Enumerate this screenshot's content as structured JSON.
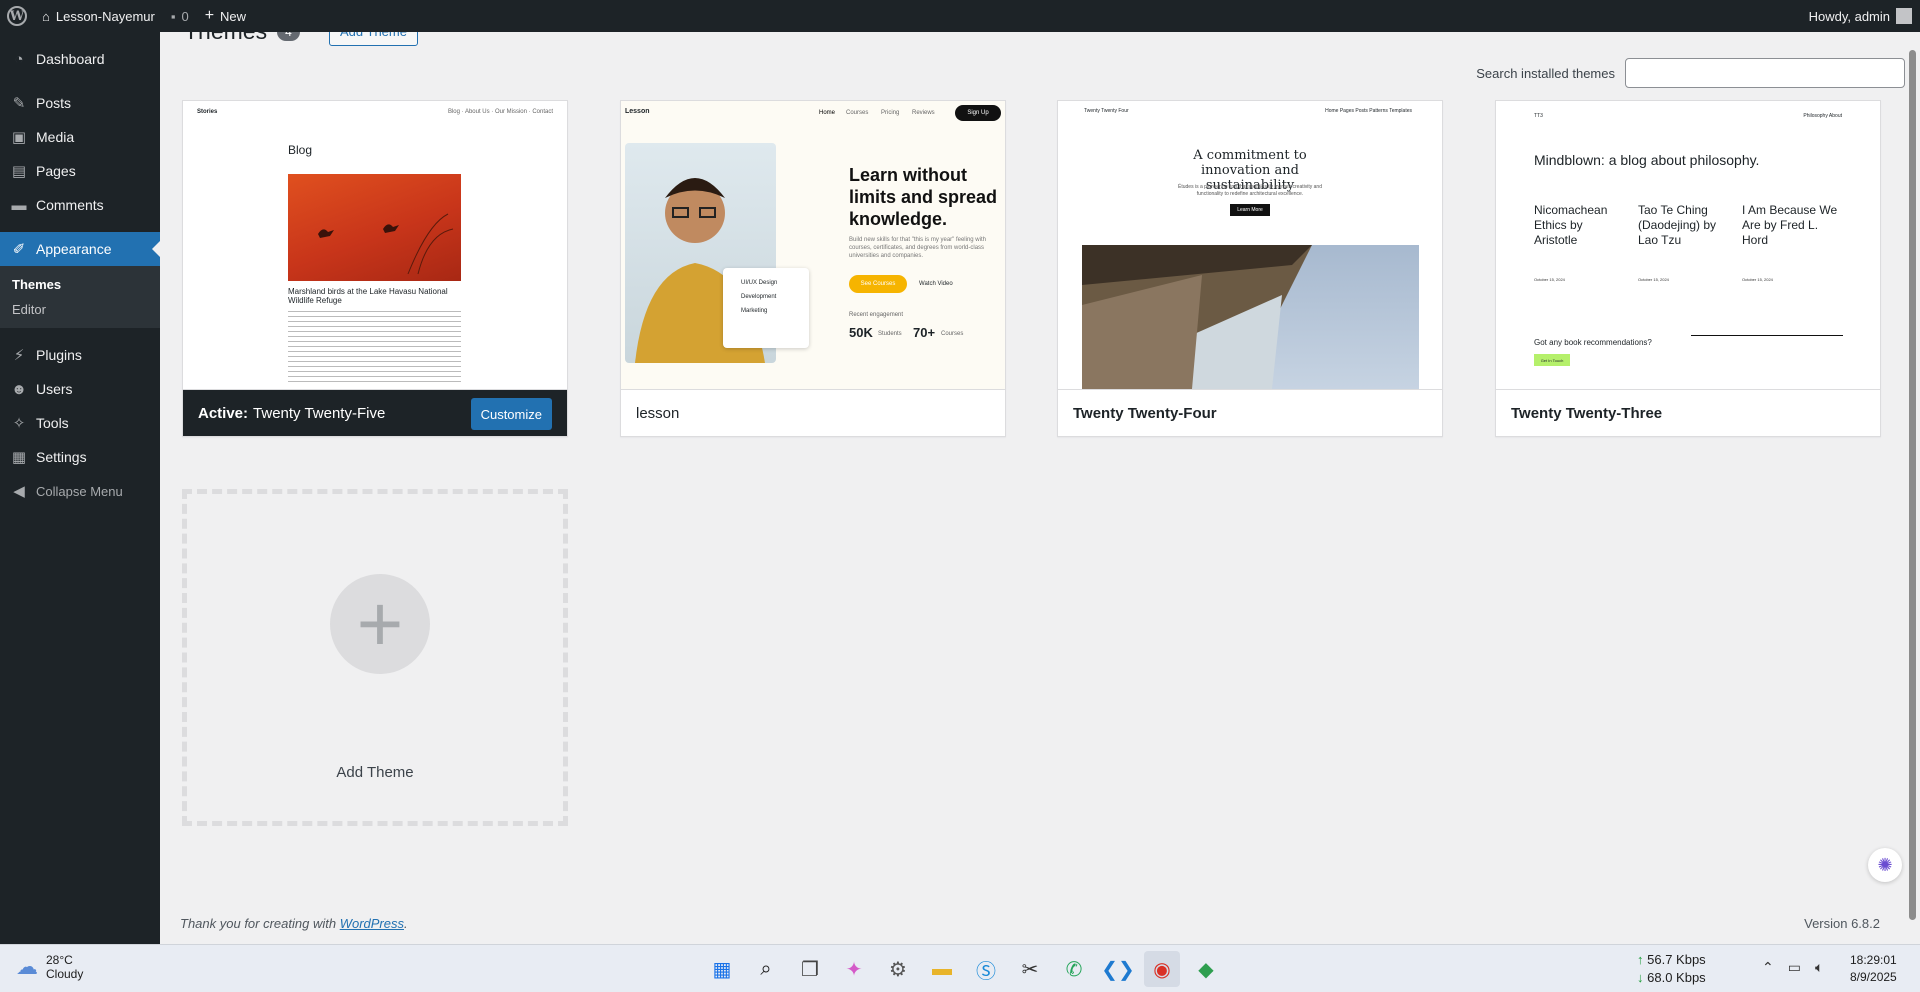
{
  "adminbar": {
    "site_name": "Lesson-Nayemur",
    "comments_count": "0",
    "new_label": "New",
    "howdy": "Howdy, admin"
  },
  "sidebar": {
    "items": [
      {
        "label": "Dashboard",
        "icon": "dashboard-icon"
      },
      {
        "label": "Posts",
        "icon": "pin-icon"
      },
      {
        "label": "Media",
        "icon": "media-icon"
      },
      {
        "label": "Pages",
        "icon": "pages-icon"
      },
      {
        "label": "Comments",
        "icon": "comment-icon"
      },
      {
        "label": "Appearance",
        "icon": "brush-icon"
      },
      {
        "label": "Plugins",
        "icon": "plugin-icon"
      },
      {
        "label": "Users",
        "icon": "users-icon"
      },
      {
        "label": "Tools",
        "icon": "wrench-icon"
      },
      {
        "label": "Settings",
        "icon": "settings-icon"
      }
    ],
    "submenu": [
      "Themes",
      "Editor"
    ],
    "collapse_label": "Collapse Menu"
  },
  "main": {
    "title": "Themes",
    "count": "4",
    "add_button": "Add Theme",
    "search_label": "Search installed themes",
    "search_value": "",
    "themes": [
      {
        "name": "Twenty Twenty-Five",
        "active_prefix": "Active:",
        "customize_label": "Customize",
        "preview": {
          "brand": "Stories",
          "nav": "Blog · About Us · Our Mission · Contact",
          "heading": "Blog",
          "caption": "Marshland birds at the Lake Havasu National Wildlife Refuge"
        }
      },
      {
        "name": "lesson",
        "preview": {
          "brand": "Lesson",
          "nav": [
            "Home",
            "Courses",
            "Pricing",
            "Reviews"
          ],
          "signup": "Sign Up",
          "headline": "Learn without limits and spread knowledge.",
          "sub": "Build new skills for that \"this is my year\" feeling with courses, certificates, and degrees from world-class universities and companies.",
          "cta": "See Courses",
          "watch": "Watch Video",
          "recent": "Recent engagement",
          "stat1": "50K",
          "stat1_label": "Students",
          "stat2": "70+",
          "stat2_label": "Courses",
          "card_items": [
            "UI/UX Design",
            "Development",
            "Marketing"
          ]
        }
      },
      {
        "name": "Twenty Twenty-Four",
        "preview": {
          "brand": "Twenty Twenty Four",
          "nav": "Home  Pages  Posts  Patterns  Templates",
          "headline": "A commitment to innovation and sustainability",
          "sub": "Études is a pioneering firm that seamlessly merges creativity and functionality to redefine architectural excellence.",
          "button": "Learn More"
        }
      },
      {
        "name": "Twenty Twenty-Three",
        "preview": {
          "brand": "TT3",
          "nav": "Philosophy   About",
          "headline": "Mindblown: a blog about philosophy.",
          "posts": [
            "Nicomachean Ethics by Aristotle",
            "Tao Te Ching (Daodejing) by Lao Tzu",
            "I Am Because We Are by Fred L. Hord"
          ],
          "dates": [
            "October 15, 2024",
            "October 15, 2024",
            "October 15, 2024"
          ],
          "ask": "Got any book recommendations?",
          "button": "Get In Touch"
        }
      }
    ],
    "add_theme_label": "Add Theme"
  },
  "footer": {
    "thanks_prefix": "Thank you for creating with",
    "wordpress_link": "WordPress",
    "period": ".",
    "version": "Version 6.8.2"
  },
  "taskbar": {
    "temperature": "28°C",
    "weather": "Cloudy",
    "net_up": "56.7 Kbps",
    "net_down": "68.0 Kbps",
    "time": "18:29:01",
    "date": "8/9/2025"
  },
  "colors": {
    "admin_dark": "#1d2327",
    "accent": "#2271b1",
    "page_bg": "#f0f0f1"
  }
}
